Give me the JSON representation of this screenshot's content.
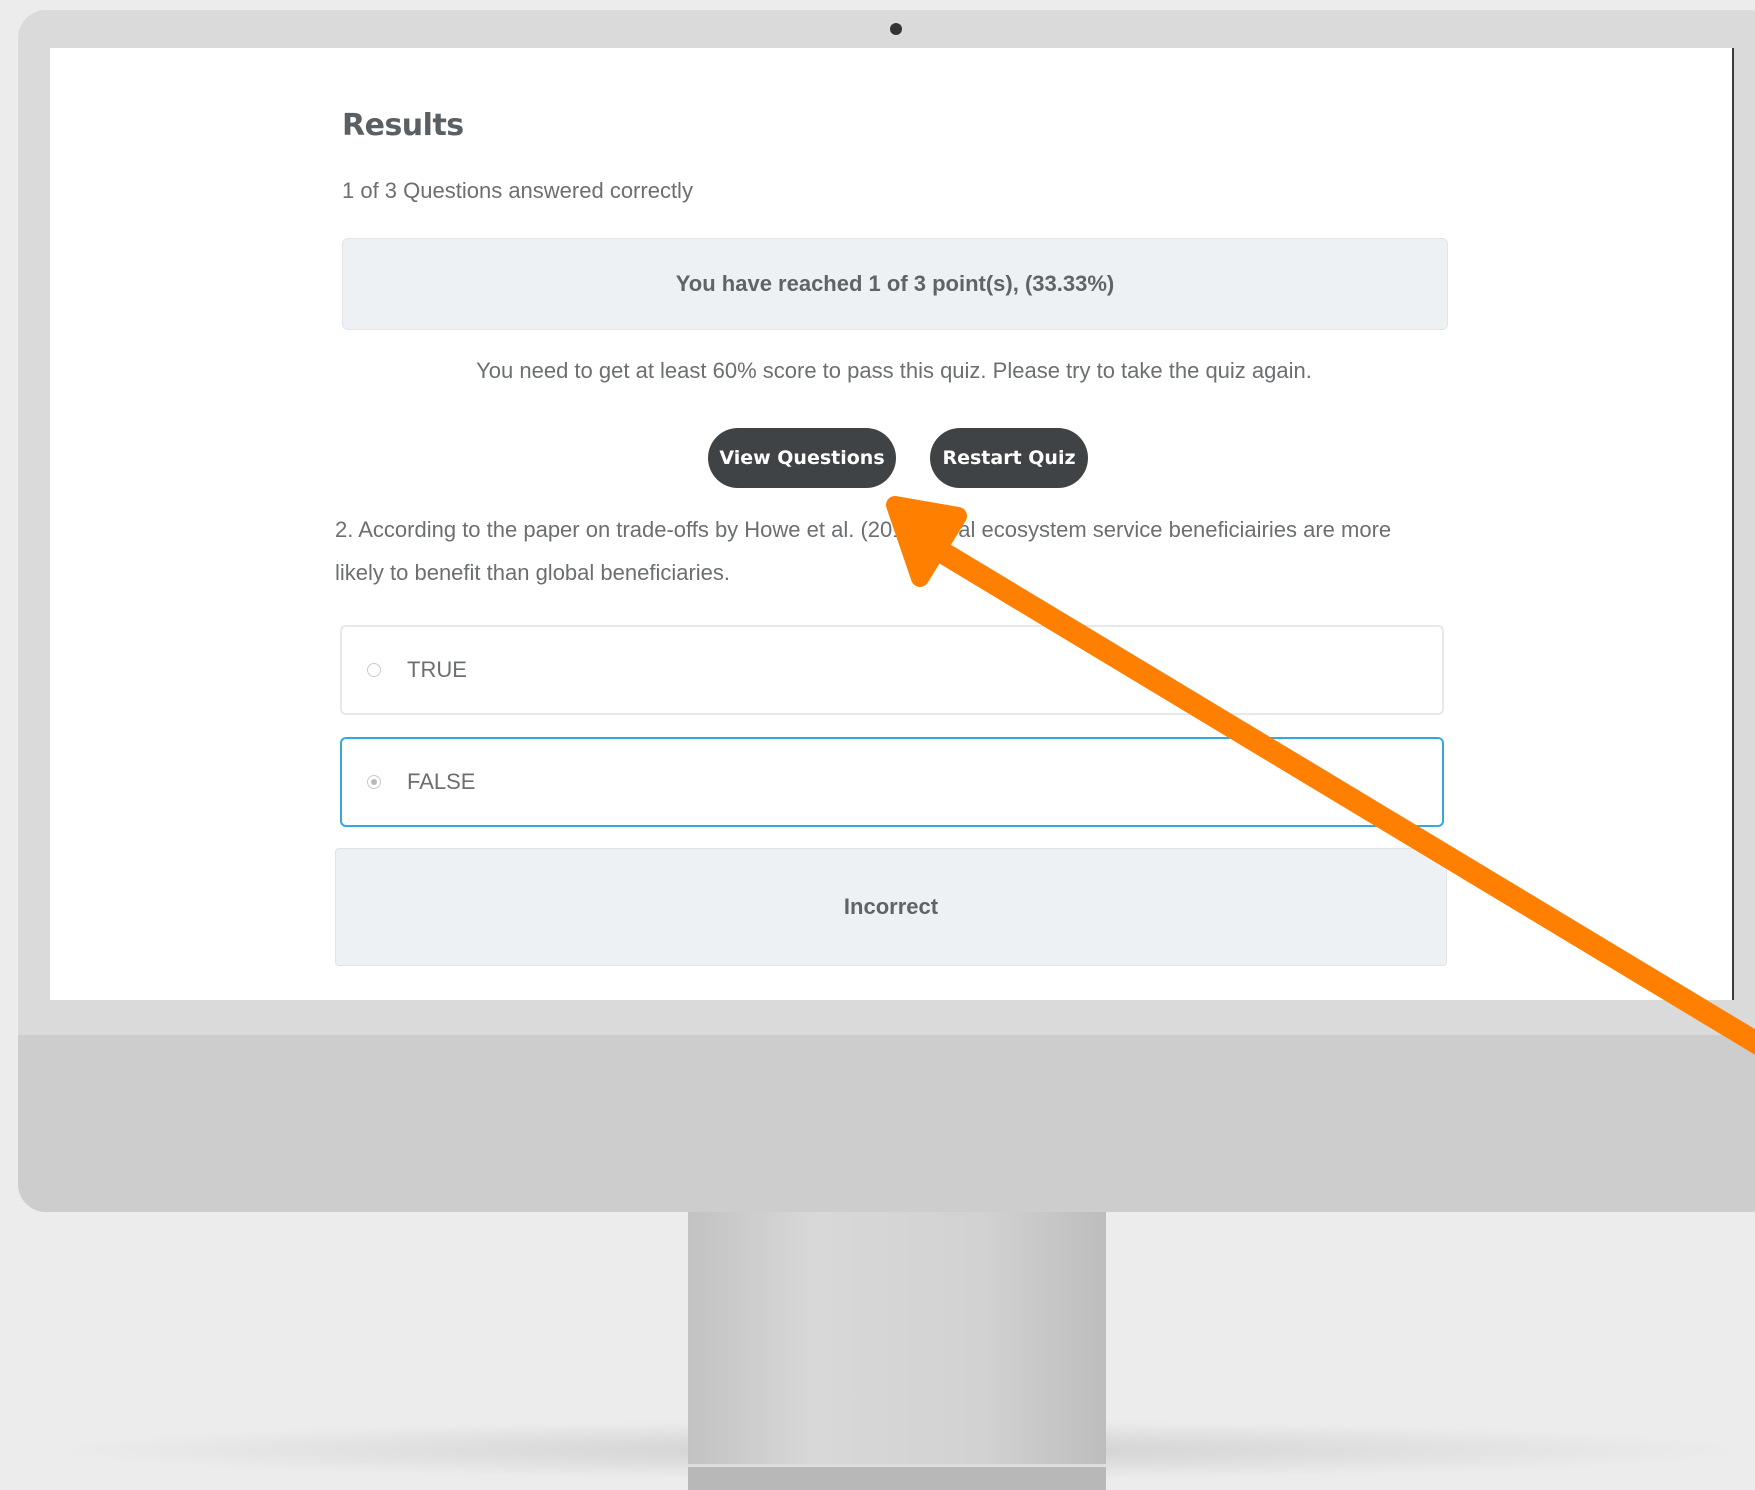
{
  "results": {
    "title": "Results",
    "answered": "1 of 3 Questions answered correctly",
    "points": "You have reached 1 of 3 point(s), (33.33%)",
    "pass_message": "You need to get at least 60% score to pass this quiz. Please try to take the quiz again."
  },
  "buttons": {
    "view_questions": "View Questions",
    "restart_quiz": "Restart Quiz"
  },
  "question": {
    "text_line1": "2. According to the paper on trade-offs by Howe et al. (2014) local ecosystem service beneficiairies are more",
    "text_line2": "likely to benefit than global beneficiaries.",
    "options": [
      {
        "label": "TRUE",
        "selected": false
      },
      {
        "label": "FALSE",
        "selected": true
      }
    ],
    "feedback": "Incorrect"
  },
  "colors": {
    "button_bg": "#3f4346",
    "selected_border": "#35a8e0",
    "arrow": "#ff7f00",
    "box_bg": "#eef1f3"
  },
  "icons": {
    "annotation": "arrow-icon",
    "radio": "radio-icon"
  }
}
